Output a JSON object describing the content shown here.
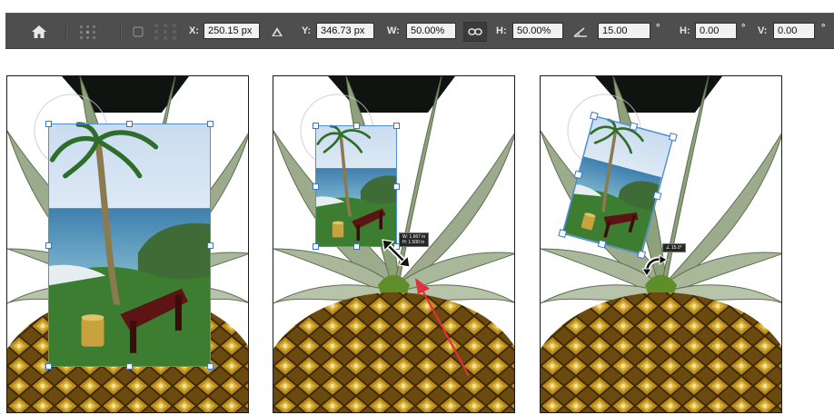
{
  "options_bar": {
    "home_icon": "home-icon",
    "reference_point_icon": "reference-point-icon",
    "checkbox_icon": "checkbox-icon",
    "x_label": "X:",
    "x_value": "250.15 px",
    "delta_icon": "delta-icon",
    "y_label": "Y:",
    "y_value": "346.73 px",
    "w_label": "W:",
    "w_value": "50.00%",
    "link_icon": "link-icon",
    "h_label": "H:",
    "h_value": "50.00%",
    "angle_icon": "angle-icon",
    "angle_value": "15.00",
    "degree_symbol": "°",
    "hskew_label": "H:",
    "hskew_value": "0.00",
    "vskew_label": "V:",
    "vskew_value": "0.00"
  },
  "panels": [
    {
      "name": "scale-panel"
    },
    {
      "name": "resize-panel",
      "tooltip_line1": "W: 1.667 in",
      "tooltip_line2": "H: 1.500 in"
    },
    {
      "name": "rotate-panel",
      "tooltip": "∠ 15.0°"
    }
  ],
  "colors": {
    "toolbar_bg": "#4e4e4e",
    "field_bg": "#f1f1f1",
    "bbox_blue": "#4f8fd6",
    "arrow_red": "#e0303c"
  }
}
